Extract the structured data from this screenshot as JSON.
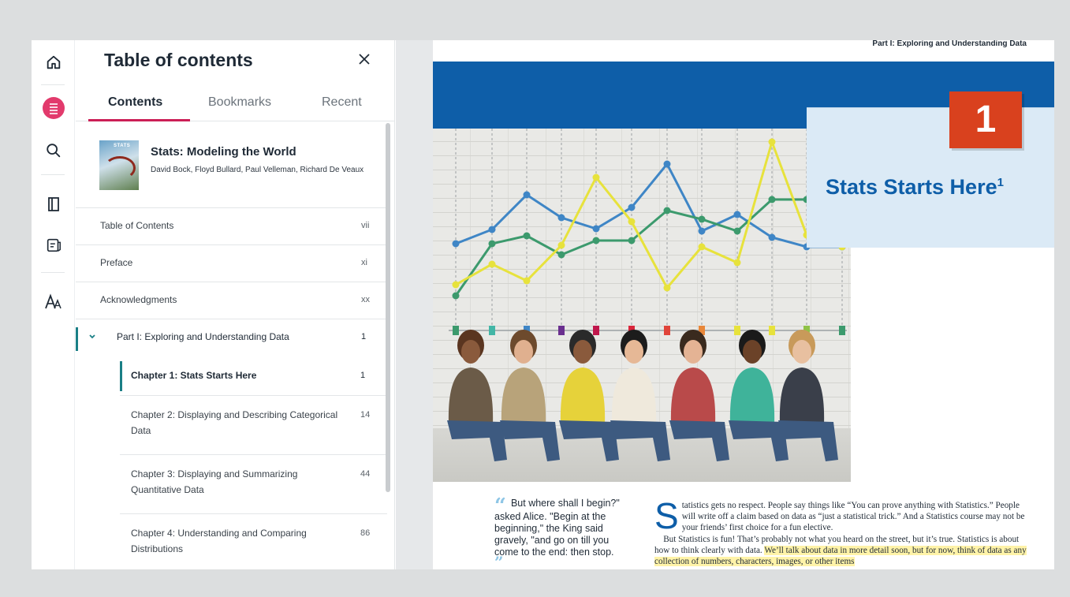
{
  "rail": {
    "icons": [
      "home-icon",
      "toc-list-icon",
      "search-icon",
      "panel-icon",
      "notebook-icon",
      "text-size-icon"
    ]
  },
  "toc": {
    "title": "Table of contents",
    "tabs": [
      "Contents",
      "Bookmarks",
      "Recent"
    ],
    "book": {
      "cover_text": "STATS",
      "title": "Stats: Modeling the World",
      "authors": "David Bock, Floyd Bullard, Paul Velleman, Richard De Veaux"
    },
    "items": [
      {
        "label": "Table of Contents",
        "page": "vii"
      },
      {
        "label": "Preface",
        "page": "xi"
      },
      {
        "label": "Acknowledgments",
        "page": "xx"
      },
      {
        "label": "Part I: Exploring and Understanding Data",
        "page": "1"
      },
      {
        "label": "Chapter 1: Stats Starts Here",
        "page": "1"
      },
      {
        "label": "Chapter 2: Displaying and Describing Categorical Data",
        "page": "14"
      },
      {
        "label": "Chapter 3: Displaying and Summarizing Quantitative Data",
        "page": "44"
      },
      {
        "label": "Chapter 4: Understanding and Comparing Distributions",
        "page": "86"
      }
    ]
  },
  "reader": {
    "running_head": "Part I: Exploring and Understanding Data",
    "chapter_number": "1",
    "chapter_title": "Stats Starts Here",
    "chapter_footnote": "1",
    "quote": "But where shall I begin?\" asked Alice. \"Begin at the beginning,\" the King said gravely, \"and go on till you come to the end: then stop.",
    "body": {
      "dropcap": "S",
      "p1": "tatistics gets no respect. People say things like “You can prove anything with Statistics.” People will write off a claim based on data as “just a statistical trick.” And a Statistics course may not be your friends’ first choice for a fun elective.",
      "p2a": "But Statistics is fun! That’s probably not what you heard on the street, but it’s true. Statistics is about how to think clearly with data. ",
      "p2_hl": "We’ll talk about data in more detail soon, but for now, think of data as any collection of numbers, characters, images, or other items"
    }
  },
  "colors": {
    "accent_pink": "#cc1f56",
    "accent_teal": "#1a7f86",
    "banner_blue": "#0e5ea8",
    "chapter_orange": "#d9411e",
    "chart_blue": "#3f86c6",
    "chart_green": "#3c9a6d",
    "chart_yellow": "#e7e23c"
  }
}
